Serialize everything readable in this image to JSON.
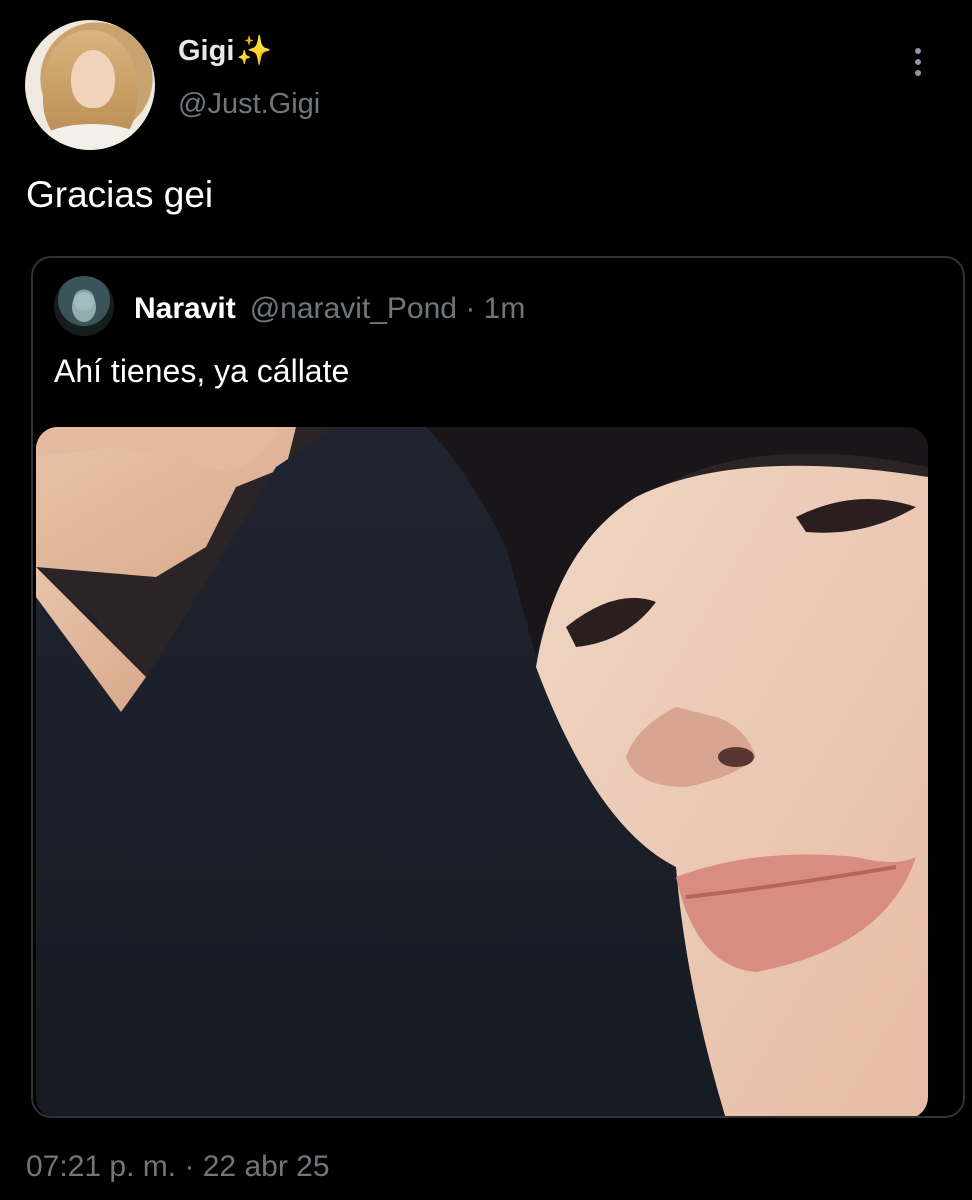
{
  "tweet": {
    "author": {
      "display_name": "Gigi",
      "emoji": "✨",
      "handle": "@Just.Gigi",
      "avatar_icon": "profile-photo-avatar"
    },
    "more_icon": "more-options-icon",
    "text": "Gracias gei",
    "timestamp": "07:21 p. m. · 22 abr 25"
  },
  "quoted_tweet": {
    "author": {
      "display_name": "Naravit",
      "handle": "@naravit_Pond",
      "separator": "·",
      "time_ago": "1m",
      "avatar_icon": "profile-photo-avatar"
    },
    "text": "Ahí tienes, ya cállate",
    "media": {
      "type": "photo",
      "icon": "photo-image"
    }
  },
  "colors": {
    "background": "#000000",
    "primary_text": "#e7e9ea",
    "secondary_text": "#71767b",
    "border": "#2f3336",
    "sparkle": "#f7c948"
  }
}
